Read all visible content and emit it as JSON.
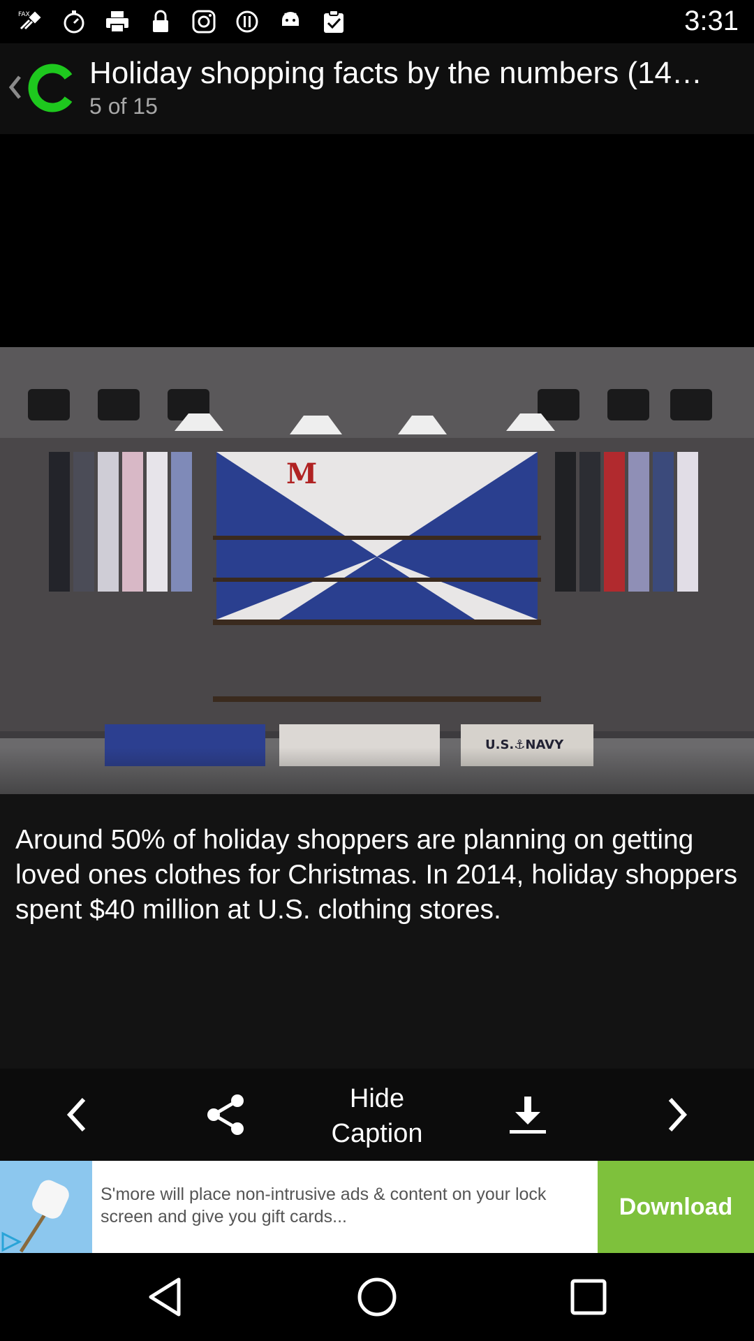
{
  "status_bar": {
    "time": "3:31",
    "icons": [
      "satellite-fax-icon",
      "stopwatch-icon",
      "printer-icon",
      "lock-icon",
      "instagram-icon",
      "info-icon",
      "android-icon",
      "clipboard-check-icon"
    ]
  },
  "header": {
    "title": "Holiday shopping facts by the numbers (14…",
    "subtitle": "5 of 15",
    "logo_color": "#1ec81e"
  },
  "photo": {
    "description_icon": "clothing-store-photo"
  },
  "caption": {
    "text": "Around 50% of holiday shoppers are planning on getting loved ones clothes for Christmas. In 2014, holiday shoppers spent $40 million at U.S. clothing stores."
  },
  "toolbar": {
    "hide_caption_label": "Hide Caption",
    "icons": [
      "previous-icon",
      "share-icon",
      "download-icon",
      "next-icon"
    ]
  },
  "ad": {
    "text": "S'more will place non-intrusive ads & content on your lock screen and give you gift cards...",
    "button_label": "Download",
    "accent": "#7ec13c"
  },
  "navbar": {
    "icons": [
      "back-triangle-icon",
      "home-circle-icon",
      "recents-square-icon"
    ]
  }
}
